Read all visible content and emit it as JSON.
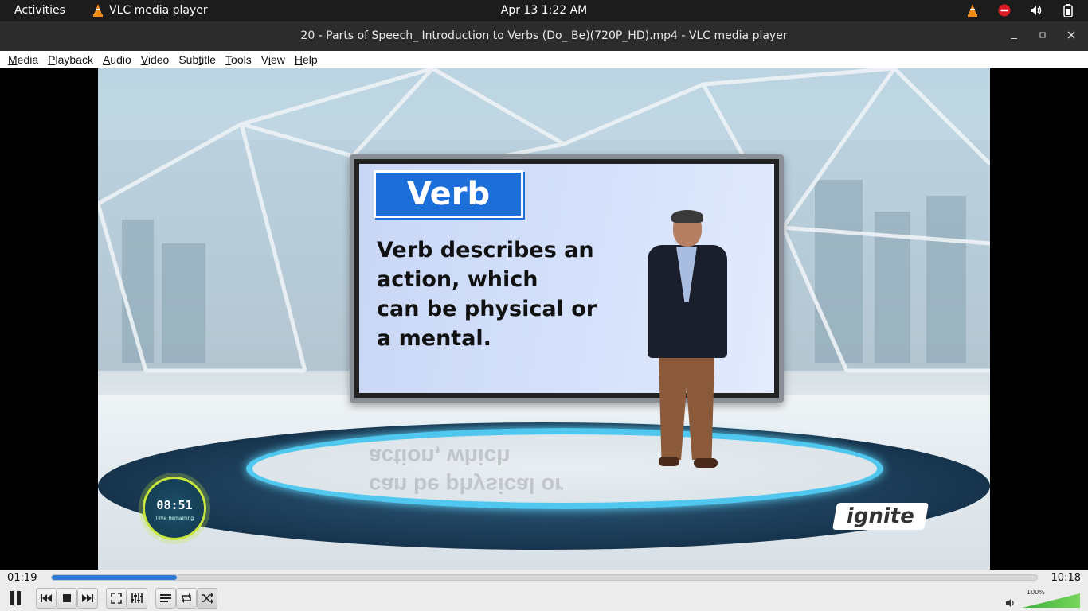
{
  "topbar": {
    "activities": "Activities",
    "app_name": "VLC media player",
    "clock": "Apr 13  1:22 AM"
  },
  "window": {
    "title": "20 - Parts of Speech_ Introduction to Verbs (Do_ Be)(720P_HD).mp4 - VLC media player"
  },
  "menu": [
    {
      "label": "Media",
      "key": "M"
    },
    {
      "label": "Playback",
      "key": "P"
    },
    {
      "label": "Audio",
      "key": "A"
    },
    {
      "label": "Video",
      "key": "V"
    },
    {
      "label": "Subtitle",
      "key": "t"
    },
    {
      "label": "Tools",
      "key": "T"
    },
    {
      "label": "View",
      "key": "i"
    },
    {
      "label": "Help",
      "key": "H"
    }
  ],
  "video": {
    "heading": "Verb",
    "lines": [
      "Verb describes an",
      "action, which",
      "can be physical or",
      "a mental."
    ],
    "reflection": [
      "can be physical or",
      "action, which"
    ],
    "timer": "08:51",
    "timer_label": "Time Remaining",
    "logo": "ignite"
  },
  "controls": {
    "time_current": "01:19",
    "time_total": "10:18",
    "progress": 0.127,
    "volume_label": "100%",
    "volume": 1.0
  },
  "colors": {
    "accent": "#2d7bd6",
    "verb_tag": "#1c6fd8",
    "volume": "#3fae3f"
  }
}
